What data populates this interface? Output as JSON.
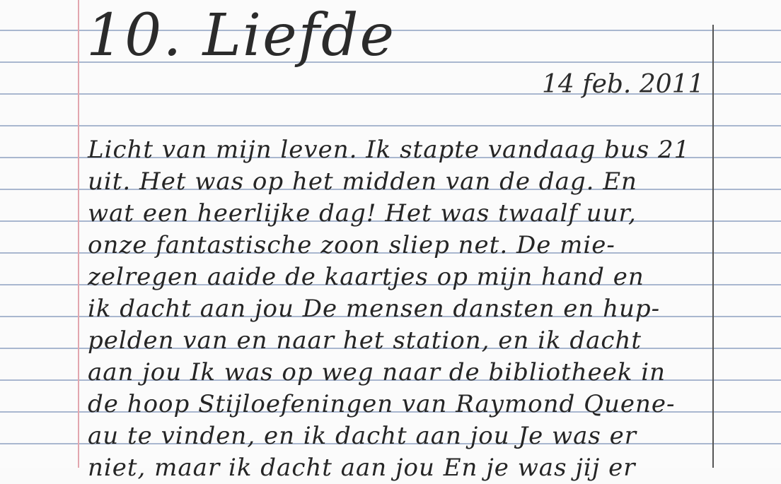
{
  "entry": {
    "title": "10. Liefde",
    "date": "14 feb. 2011",
    "lines": [
      "Licht van mijn leven. Ik stapte vandaag bus 21",
      "uit. Het was op het midden van de dag. En",
      "wat een heerlijke dag! Het was twaalf uur,",
      "onze fantastische zoon sliep net. De mie-",
      "zelregen aaide de kaartjes op mijn hand en",
      "ik dacht aan jou De mensen dansten en hup-",
      "pelden van en naar het station, en ik dacht",
      "aan jou Ik was op weg naar de bibliotheek in",
      "de hoop Stijloefeningen van Raymond Quene-",
      "au te vinden, en ik dacht aan jou Je was er",
      "niet, maar ik dacht aan jou En je was jij er"
    ]
  }
}
